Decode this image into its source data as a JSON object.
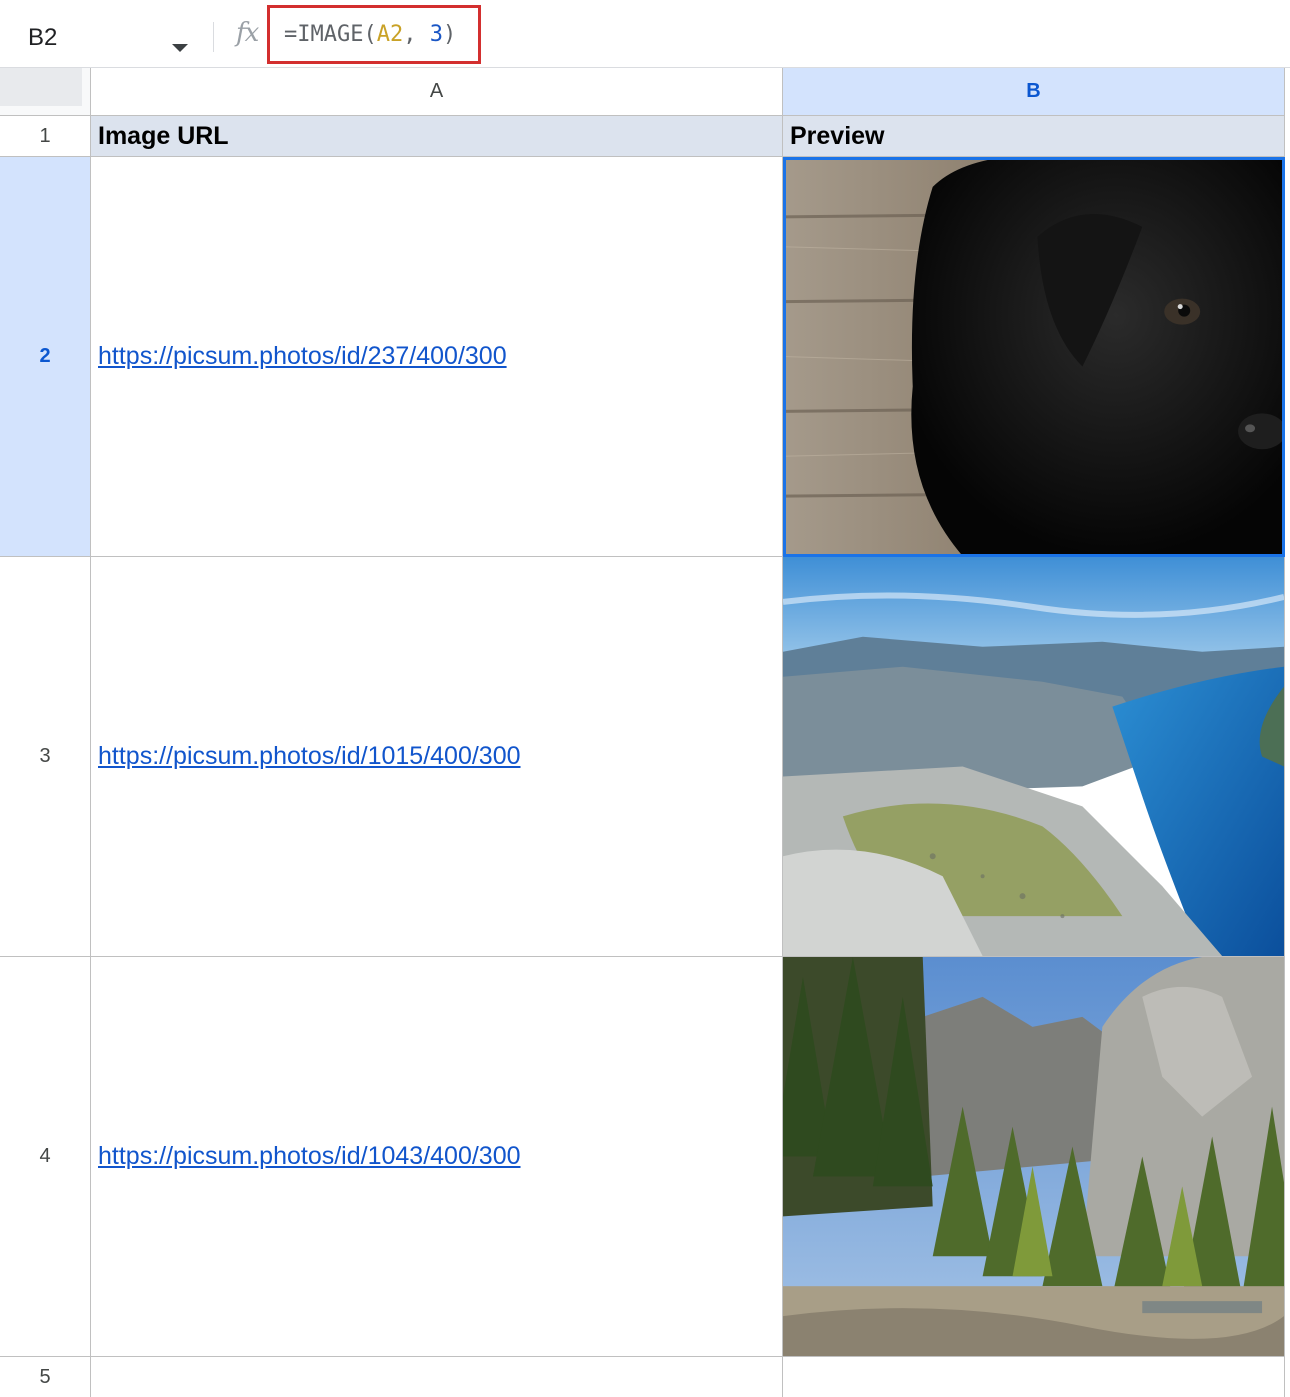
{
  "formula_bar": {
    "name_box": "B2",
    "fx_label": "fx",
    "formula_prefix": "=IMAGE(",
    "formula_ref": "A2",
    "formula_sep": ", ",
    "formula_num": "3",
    "formula_suffix": ")"
  },
  "columns": [
    "A",
    "B"
  ],
  "rows": [
    "1",
    "2",
    "3",
    "4",
    "5"
  ],
  "header_row": {
    "a": "Image URL",
    "b": "Preview"
  },
  "data_rows": [
    {
      "url": "https://picsum.photos/id/237/400/300",
      "image": "black-puppy-on-wooden-floor"
    },
    {
      "url": "https://picsum.photos/id/1015/400/300",
      "image": "fjord-cliff-landscape"
    },
    {
      "url": "https://picsum.photos/id/1043/400/300",
      "image": "forest-valley-cliffs"
    }
  ],
  "selection": {
    "cell": "B2",
    "accent": "#1a73e8"
  },
  "colors": {
    "header_fill": "#dce3ee",
    "selected_header": "#d3e3fd",
    "highlight_box": "#d32f2f",
    "link": "#1155cc"
  }
}
